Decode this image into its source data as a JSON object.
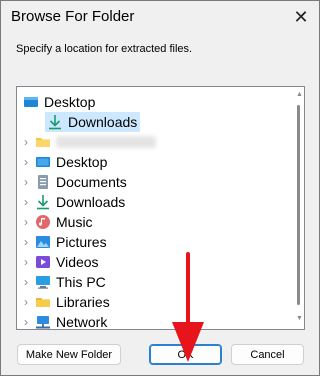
{
  "window": {
    "title": "Browse For Folder",
    "close_glyph": "✕"
  },
  "instruction": "Specify a location for extracted files.",
  "tree": {
    "items": [
      {
        "label": "Desktop",
        "icon": "desktop-folder-icon",
        "chevron": "",
        "selected": false,
        "indent": 0
      },
      {
        "label": "Downloads",
        "icon": "downloads-icon",
        "chevron": "",
        "selected": true,
        "indent": 1
      },
      {
        "label": "",
        "icon": "user-folder-icon",
        "chevron": "›",
        "selected": false,
        "indent": 1,
        "blurred": true
      },
      {
        "label": "Desktop",
        "icon": "desktop-icon",
        "chevron": "›",
        "selected": false,
        "indent": 1
      },
      {
        "label": "Documents",
        "icon": "documents-icon",
        "chevron": "›",
        "selected": false,
        "indent": 1
      },
      {
        "label": "Downloads",
        "icon": "downloads-icon",
        "chevron": "›",
        "selected": false,
        "indent": 1
      },
      {
        "label": "Music",
        "icon": "music-icon",
        "chevron": "›",
        "selected": false,
        "indent": 1
      },
      {
        "label": "Pictures",
        "icon": "pictures-icon",
        "chevron": "›",
        "selected": false,
        "indent": 1
      },
      {
        "label": "Videos",
        "icon": "videos-icon",
        "chevron": "›",
        "selected": false,
        "indent": 1
      },
      {
        "label": "This PC",
        "icon": "this-pc-icon",
        "chevron": "›",
        "selected": false,
        "indent": 1
      },
      {
        "label": "Libraries",
        "icon": "libraries-icon",
        "chevron": "›",
        "selected": false,
        "indent": 1
      },
      {
        "label": "Network",
        "icon": "network-icon",
        "chevron": "›",
        "selected": false,
        "indent": 1
      }
    ]
  },
  "buttons": {
    "make_new_folder": "Make New Folder",
    "ok": "OK",
    "cancel": "Cancel"
  },
  "colors": {
    "selection": "#cce8ff",
    "annotation_arrow": "#e8141c"
  }
}
